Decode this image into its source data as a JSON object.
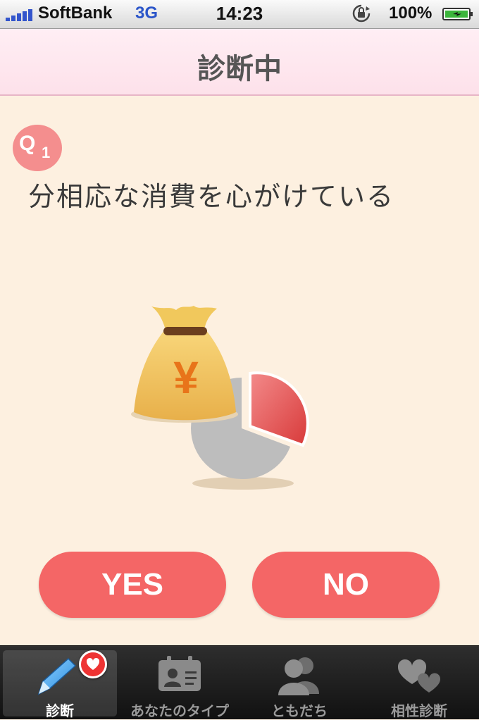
{
  "status_bar": {
    "carrier": "SoftBank",
    "network": "3G",
    "time": "14:23",
    "battery": "100%",
    "icons": [
      "signal-icon",
      "rotation-lock-icon",
      "battery-icon"
    ]
  },
  "nav": {
    "title": "診断中"
  },
  "question": {
    "badge_letter": "Q",
    "number": "1",
    "text": "分相応な消費を心がけている",
    "illustration_currency": "¥"
  },
  "answers": {
    "yes": "YES",
    "no": "NO"
  },
  "tabs": [
    {
      "label": "診断",
      "icon": "pencil-icon",
      "active": true
    },
    {
      "label": "あなたのタイプ",
      "icon": "profile-card-icon",
      "active": false
    },
    {
      "label": "ともだち",
      "icon": "people-icon",
      "active": false
    },
    {
      "label": "相性診断",
      "icon": "hearts-icon",
      "active": false
    }
  ],
  "colors": {
    "background": "#fdf0e0",
    "accent": "#f46666",
    "badge": "#f48e8e",
    "navbar": "#ffeef4"
  }
}
